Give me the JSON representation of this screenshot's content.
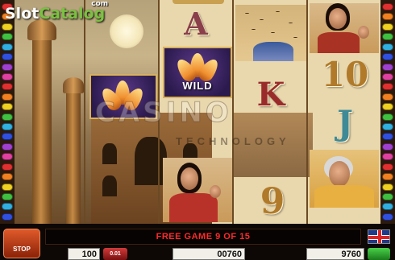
{
  "logo": {
    "slot": "Slot",
    "catalog": "Catalog",
    "com": "com"
  },
  "watermark": {
    "main": "CASINO",
    "sub": "TECHNOLOGY"
  },
  "reels": {
    "wild_label": "WILD",
    "symbols": {
      "a": "A",
      "k": "K",
      "j": "J",
      "ten": "10",
      "nine": "9"
    }
  },
  "controls": {
    "stop_label": "STOP",
    "banner": "FREE GAME 9 OF 15",
    "bet_value": "100",
    "bet_badge": "0.01",
    "win_value": "00760",
    "credit_value": "9760"
  },
  "colors": {
    "banner_text": "#ff2a2a",
    "logo_green": "#7bc142",
    "stop_button": "#e05a2a"
  },
  "icons": [
    "flag-uk-icon"
  ]
}
